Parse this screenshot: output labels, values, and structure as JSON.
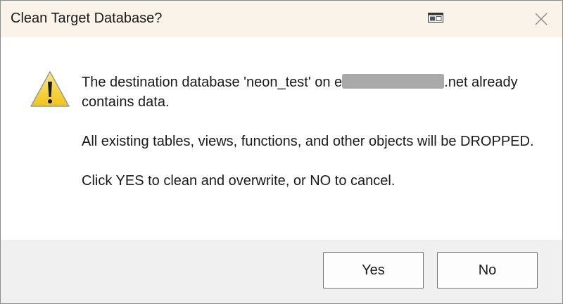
{
  "dialog": {
    "title": "Clean Target Database?",
    "message_line1_before": "The destination database 'neon_test' on e",
    "message_line1_after": ".net already contains data.",
    "message_line2": "All existing tables, views, functions, and other objects will be DROPPED.",
    "message_line3": "Click YES to clean and overwrite, or NO to cancel."
  },
  "buttons": {
    "yes_label": "Yes",
    "no_label": "No"
  },
  "icons": {
    "warning": "warning-triangle-icon",
    "window": "window-snap-icon",
    "close": "close-icon"
  },
  "colors": {
    "titlebar_bg": "#f9f3ea",
    "content_bg": "#ffffff",
    "button_bar_bg": "#f0f0f0",
    "warning_yellow": "#f5d232",
    "redaction_gray": "#a9a9a9"
  }
}
